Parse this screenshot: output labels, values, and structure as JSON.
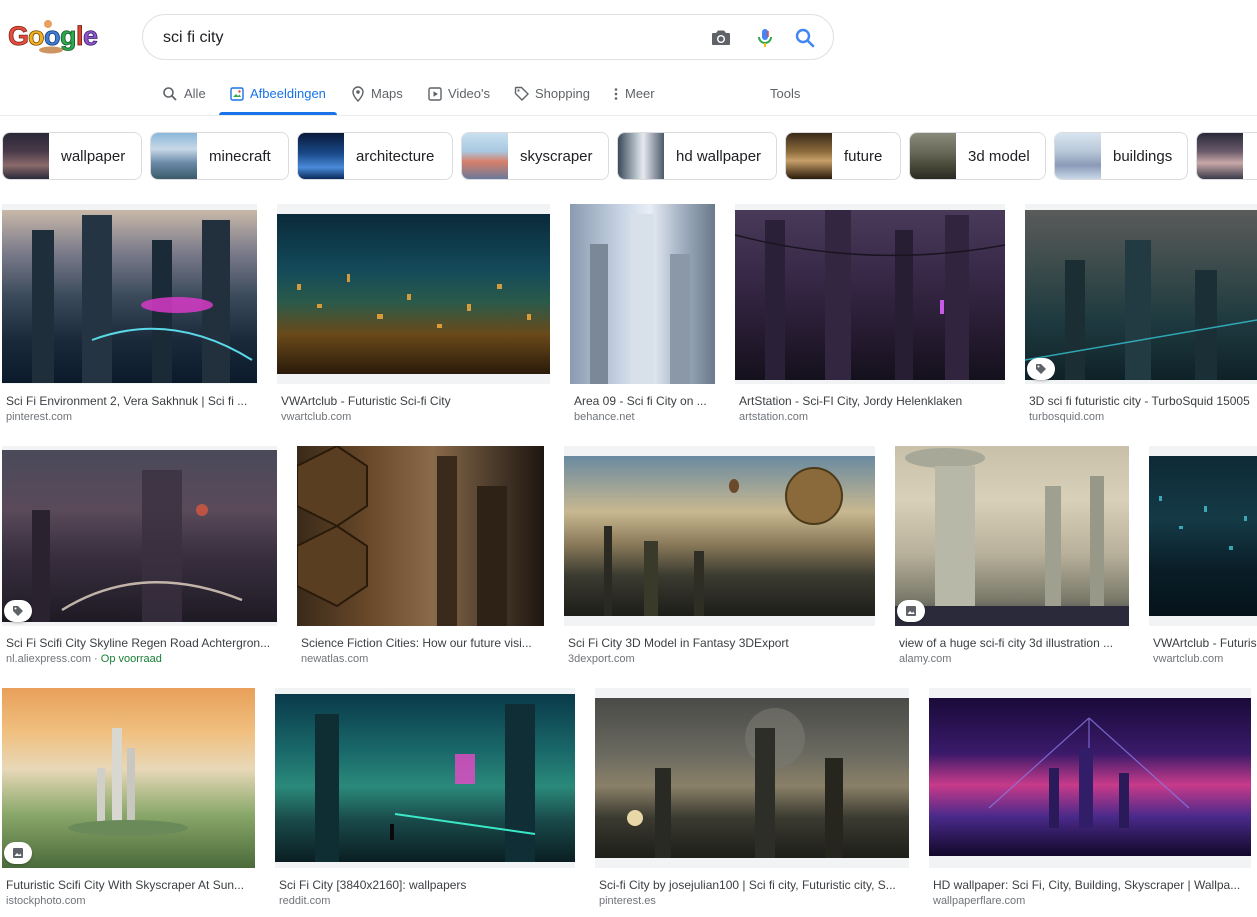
{
  "search": {
    "query": "sci fi city"
  },
  "logo": {
    "letters": [
      "G",
      "o",
      "o",
      "g",
      "l",
      "e"
    ]
  },
  "tabs": [
    {
      "label": "Alle",
      "icon": "search-icon"
    },
    {
      "label": "Afbeeldingen",
      "icon": "image-icon"
    },
    {
      "label": "Maps",
      "icon": "map-pin-icon"
    },
    {
      "label": "Video's",
      "icon": "play-icon"
    },
    {
      "label": "Shopping",
      "icon": "tag-icon"
    },
    {
      "label": "Meer",
      "icon": "more-vert-icon"
    }
  ],
  "tools_label": "Tools",
  "chips": [
    {
      "label": "wallpaper"
    },
    {
      "label": "minecraft"
    },
    {
      "label": "architecture"
    },
    {
      "label": "skyscraper"
    },
    {
      "label": "hd wallpaper"
    },
    {
      "label": "future"
    },
    {
      "label": "3d model"
    },
    {
      "label": "buildings"
    },
    {
      "label": ""
    }
  ],
  "results": [
    {
      "caption": "Sci Fi Environment 2, Vera Sakhnuk | Sci fi ...",
      "source": "pinterest.com"
    },
    {
      "caption": "VWArtclub - Futuristic Sci-fi City",
      "source": "vwartclub.com"
    },
    {
      "caption": "Area 09 - Sci fi City on ...",
      "source": "behance.net"
    },
    {
      "caption": "ArtStation - Sci-FI City, Jordy Helenklaken",
      "source": "artstation.com"
    },
    {
      "caption": "3D sci fi futuristic city - TurboSquid 15005",
      "source": "turbosquid.com"
    },
    {
      "caption": "Sci Fi Scifi City Skyline Regen Road Achtergron...",
      "source": "nl.aliexpress.com",
      "stock": "Op voorraad"
    },
    {
      "caption": "Science Fiction Cities: How our future visi...",
      "source": "newatlas.com"
    },
    {
      "caption": "Sci Fi City 3D Model in Fantasy 3DExport",
      "source": "3dexport.com"
    },
    {
      "caption": "view of a huge sci-fi city 3d illustration ...",
      "source": "alamy.com"
    },
    {
      "caption": "VWArtclub - Futuris",
      "source": "vwartclub.com"
    },
    {
      "caption": "Futuristic Scifi City With Skyscraper At Sun...",
      "source": "istockphoto.com"
    },
    {
      "caption": "Sci Fi City [3840x2160]: wallpapers",
      "source": "reddit.com"
    },
    {
      "caption": "Sci-fi City by josejulian100 | Sci fi city, Futuristic city, S...",
      "source": "pinterest.es"
    },
    {
      "caption": "HD wallpaper: Sci Fi, City, Building, Skyscraper | Wallpa...",
      "source": "wallpaperflare.com"
    }
  ],
  "colors": {
    "accent": "#1a73e8",
    "in_stock": "#188038"
  }
}
